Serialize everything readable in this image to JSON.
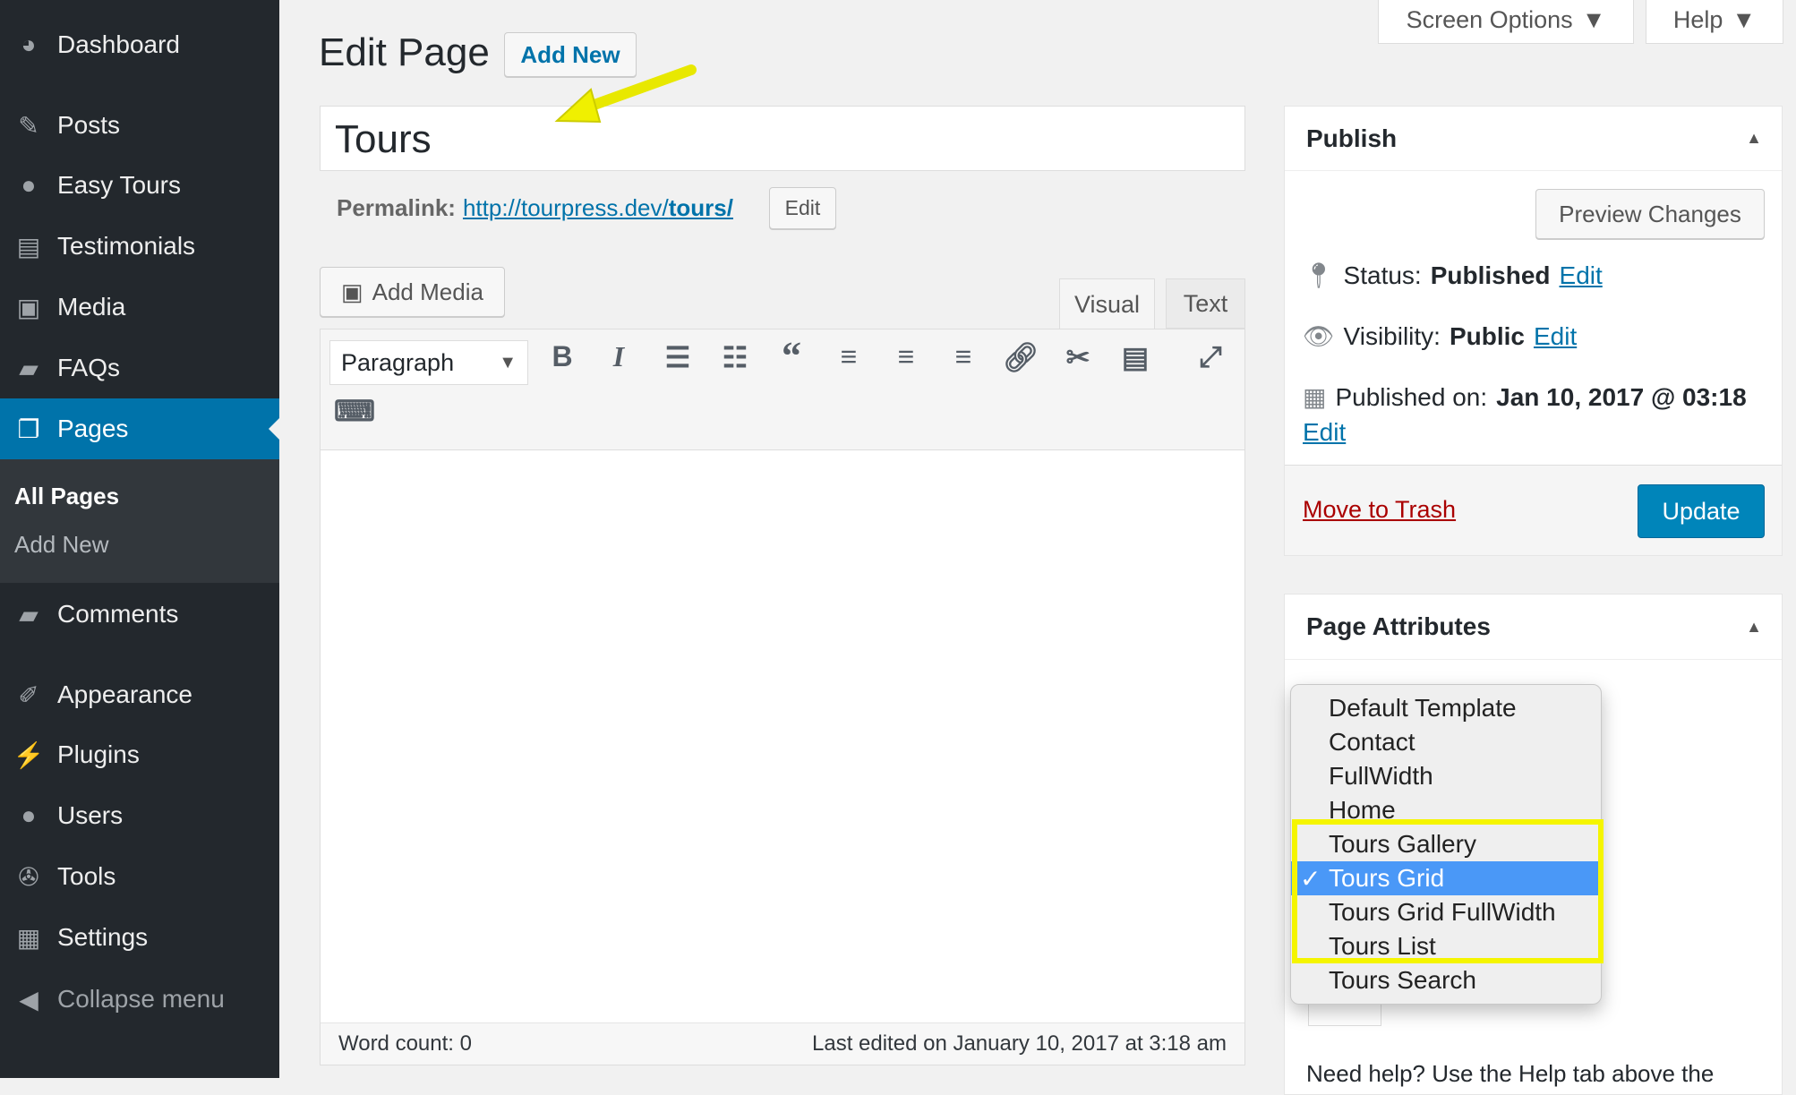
{
  "sidebar": {
    "items": [
      {
        "label": "Dashboard",
        "icon": "dashboard-icon"
      },
      {
        "label": "Posts",
        "icon": "pin-icon"
      },
      {
        "label": "Easy Tours",
        "icon": "globe-icon"
      },
      {
        "label": "Testimonials",
        "icon": "comment-icon"
      },
      {
        "label": "Media",
        "icon": "media-icon"
      },
      {
        "label": "FAQs",
        "icon": "chat-icon"
      },
      {
        "label": "Pages",
        "icon": "pages-icon"
      },
      {
        "label": "Comments",
        "icon": "comment-icon"
      },
      {
        "label": "Appearance",
        "icon": "brush-icon"
      },
      {
        "label": "Plugins",
        "icon": "plug-icon"
      },
      {
        "label": "Users",
        "icon": "user-icon"
      },
      {
        "label": "Tools",
        "icon": "wrench-icon"
      },
      {
        "label": "Settings",
        "icon": "settings-icon"
      },
      {
        "label": "Collapse menu",
        "icon": "collapse-icon"
      }
    ],
    "submenu": [
      "All Pages",
      "Add New"
    ]
  },
  "header": {
    "title": "Edit Page",
    "add_new": "Add New",
    "screen_options": "Screen Options",
    "help": "Help"
  },
  "editor": {
    "title_value": "Tours",
    "permalink_label": "Permalink:",
    "permalink_base": "http://tourpress.dev/",
    "permalink_slug": "tours/",
    "permalink_edit": "Edit",
    "add_media": "Add Media",
    "tab_visual": "Visual",
    "tab_text": "Text",
    "format": "Paragraph",
    "word_count": "Word count: 0",
    "last_edited": "Last edited on January 10, 2017 at 3:18 am"
  },
  "publish": {
    "title": "Publish",
    "preview": "Preview Changes",
    "status_label": "Status:",
    "status_value": "Published",
    "visibility_label": "Visibility:",
    "visibility_value": "Public",
    "published_label": "Published on:",
    "published_value": "Jan 10, 2017 @ 03:18",
    "edit": "Edit",
    "trash": "Move to Trash",
    "update": "Update"
  },
  "attributes": {
    "title": "Page Attributes",
    "templates": [
      "Default Template",
      "Contact",
      "FullWidth",
      "Home",
      "Tours Gallery",
      "Tours Grid",
      "Tours Grid FullWidth",
      "Tours List",
      "Tours Search"
    ],
    "selected": "Tours Grid",
    "help": "Need help? Use the Help tab above the"
  },
  "colors": {
    "accent": "#0073aa",
    "highlight": "#ffff00",
    "selected": "#4a98f7"
  }
}
